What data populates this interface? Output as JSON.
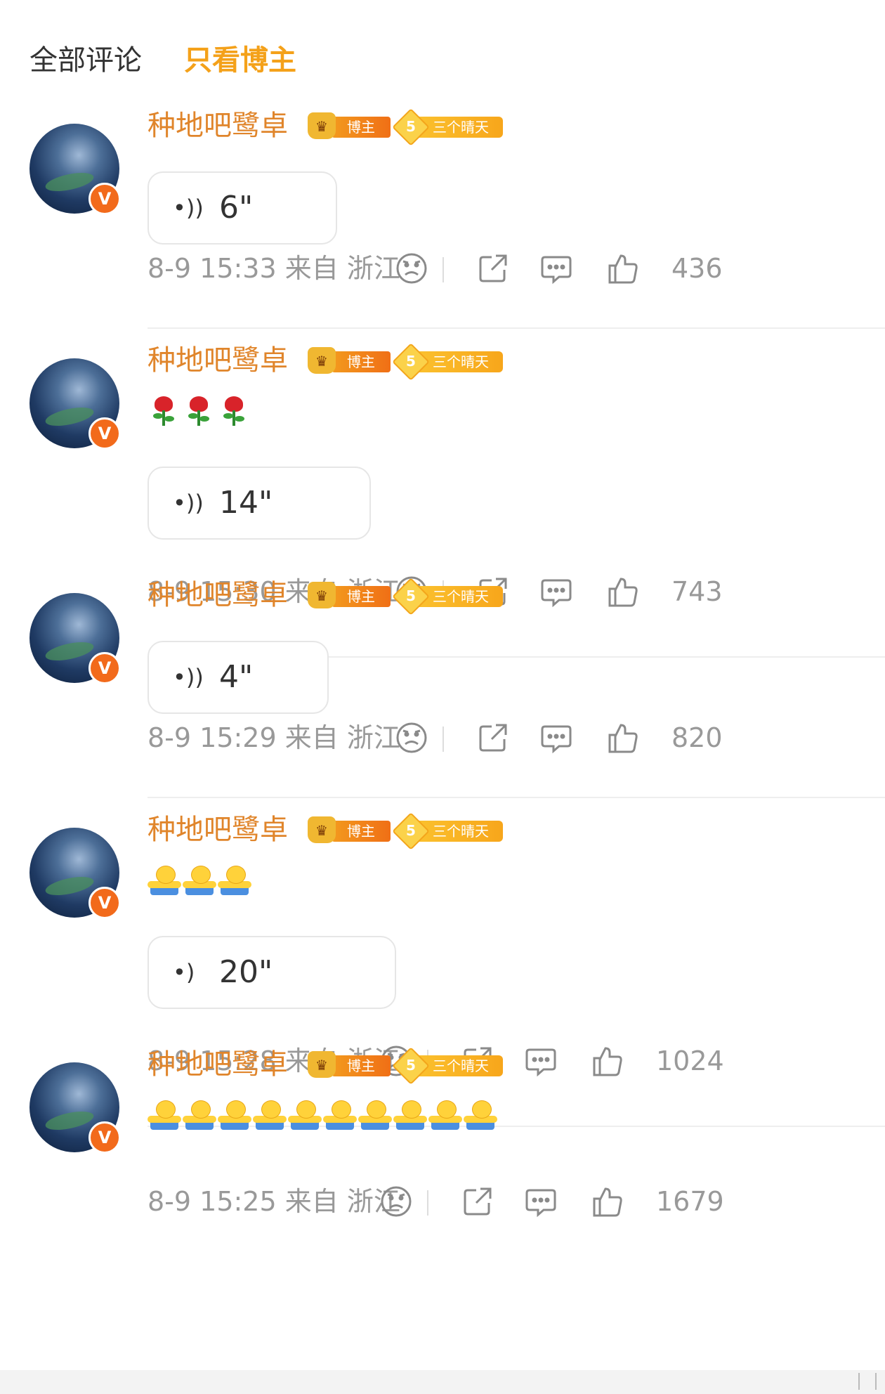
{
  "tabs": {
    "all": "全部评论",
    "blogger_only": "只看博主"
  },
  "colors": {
    "accent": "#f4a11a",
    "username": "#e0852b",
    "meta": "#999999"
  },
  "badges": {
    "blogger": "博主",
    "fan_level": "5",
    "fan_label": "三个晴天",
    "verified_glyph": "V"
  },
  "comments": [
    {
      "username": "种地吧鹭卓",
      "emoji": [],
      "voice": "6\"",
      "time": "8-9 15:33 来自 浙江",
      "likes": "436"
    },
    {
      "username": "种地吧鹭卓",
      "emoji": [
        "rose-icon",
        "rose-icon",
        "rose-icon"
      ],
      "voice": "14\"",
      "time": "8-9 15:30 来自 浙江",
      "likes": "743"
    },
    {
      "username": "种地吧鹭卓",
      "emoji": [],
      "voice": "4\"",
      "time": "8-9 15:29 来自 浙江",
      "likes": "820"
    },
    {
      "username": "种地吧鹭卓",
      "emoji": [
        "hug-icon",
        "hug-icon",
        "hug-icon"
      ],
      "voice": "20\"",
      "time": "8-9 15:28 来自 浙江",
      "likes": "1024"
    },
    {
      "username": "种地吧鹭卓",
      "emoji": [
        "hug-icon",
        "hug-icon",
        "hug-icon",
        "hug-icon",
        "hug-icon",
        "hug-icon",
        "hug-icon",
        "hug-icon",
        "hug-icon",
        "hug-icon"
      ],
      "voice": "",
      "time": "8-9 15:25 来自 浙江",
      "likes": "1679"
    }
  ]
}
